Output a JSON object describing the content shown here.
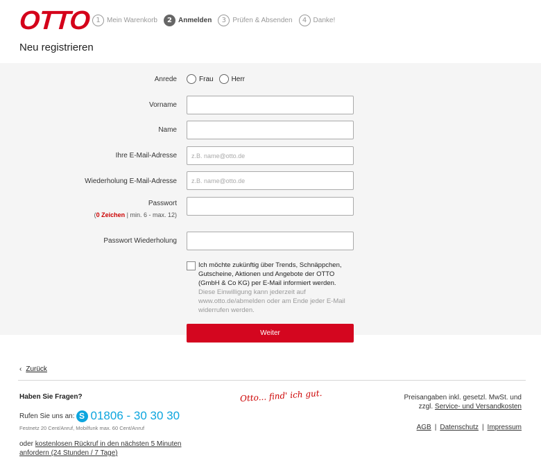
{
  "header": {
    "logo": "OTTO",
    "steps": [
      {
        "num": "1",
        "label": "Mein Warenkorb"
      },
      {
        "num": "2",
        "label": "Anmelden"
      },
      {
        "num": "3",
        "label": "Prüfen & Absenden"
      },
      {
        "num": "4",
        "label": "Danke!"
      }
    ],
    "page_title": "Neu registrieren"
  },
  "form": {
    "anrede_label": "Anrede",
    "anrede_options": [
      "Frau",
      "Herr"
    ],
    "vorname_label": "Vorname",
    "name_label": "Name",
    "email_label": "Ihre E-Mail-Adresse",
    "email_placeholder": "z.B. name@otto.de",
    "email_repeat_label": "Wiederholung E-Mail-Adresse",
    "email_repeat_placeholder": "z.B. name@otto.de",
    "password_label": "Passwort",
    "password_hint_open": "(",
    "password_hint_count": "0 Zeichen",
    "password_hint_rest": " | min. 6 - max. 12)",
    "password_repeat_label": "Passwort Wiederholung",
    "consent_text": "Ich möchte zukünftig über Trends, Schnäppchen, Gutscheine, Aktionen und Angebote der OTTO (GmbH & Co KG) per E-Mail informiert werden.",
    "consent_sub": "Diese Einwilligung kann jederzeit auf www.otto.de/abmelden oder am Ende jeder E-Mail widerrufen werden.",
    "submit_label": "Weiter"
  },
  "back": {
    "arrow": "‹",
    "label": "Zurück"
  },
  "footer": {
    "help_title": "Haben Sie Fragen?",
    "call_prefix": "Rufen Sie uns an:",
    "skype_icon": "S",
    "phone": "01806 - 30 30 30",
    "tariff": "Festnetz 20 Cent/Anruf, Mobilfunk max. 60 Cent/Anruf",
    "callback_prefix": "oder ",
    "callback_link": "kostenlosen Rückruf in den nächsten 5 Minuten anfordern (24 Stunden / 7 Tage)",
    "slogan": "Otto... find' ich gut.",
    "price_line1": "Preisangaben inkl. gesetzl. MwSt. und",
    "price_prefix": "zzgl. ",
    "price_link": "Service- und Versandkosten",
    "links": [
      "AGB",
      "Datenschutz",
      "Impressum"
    ],
    "separator": "|"
  },
  "colors": {
    "brand": "#d4001a",
    "button": "#d4061f",
    "phone": "#0da5de",
    "form_bg": "#f5f5f5"
  }
}
